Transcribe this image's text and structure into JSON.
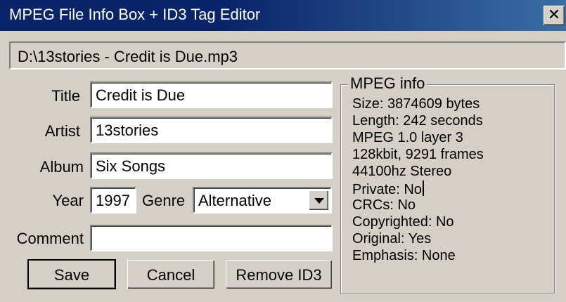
{
  "window": {
    "title": "MPEG File Info Box + ID3 Tag Editor",
    "close_glyph": "✕"
  },
  "file_path": "D:\\13stories - Credit is Due.mp3",
  "tags": {
    "title_label": "Title",
    "title_value": "Credit is Due",
    "artist_label": "Artist",
    "artist_value": "13stories",
    "album_label": "Album",
    "album_value": "Six Songs",
    "year_label": "Year",
    "year_value": "1997",
    "genre_label": "Genre",
    "genre_value": "Alternative",
    "comment_label": "Comment",
    "comment_value": ""
  },
  "buttons": {
    "save": "Save",
    "cancel": "Cancel",
    "remove_id3": "Remove ID3"
  },
  "mpeg_info": {
    "legend": "MPEG info",
    "lines": [
      "Size: 3874609 bytes",
      "Length: 242 seconds",
      "MPEG 1.0 layer 3",
      "128kbit, 9291 frames",
      "44100hz Stereo",
      "Private: No",
      "CRCs: No",
      "Copyrighted: No",
      "Original: Yes",
      "Emphasis: None"
    ]
  },
  "colors": {
    "titlebar_start": "#0a246a",
    "titlebar_end": "#3a6ea5",
    "face": "#d4d0c8"
  },
  "icons": {
    "close": "close-icon",
    "dropdown": "chevron-down-icon"
  }
}
